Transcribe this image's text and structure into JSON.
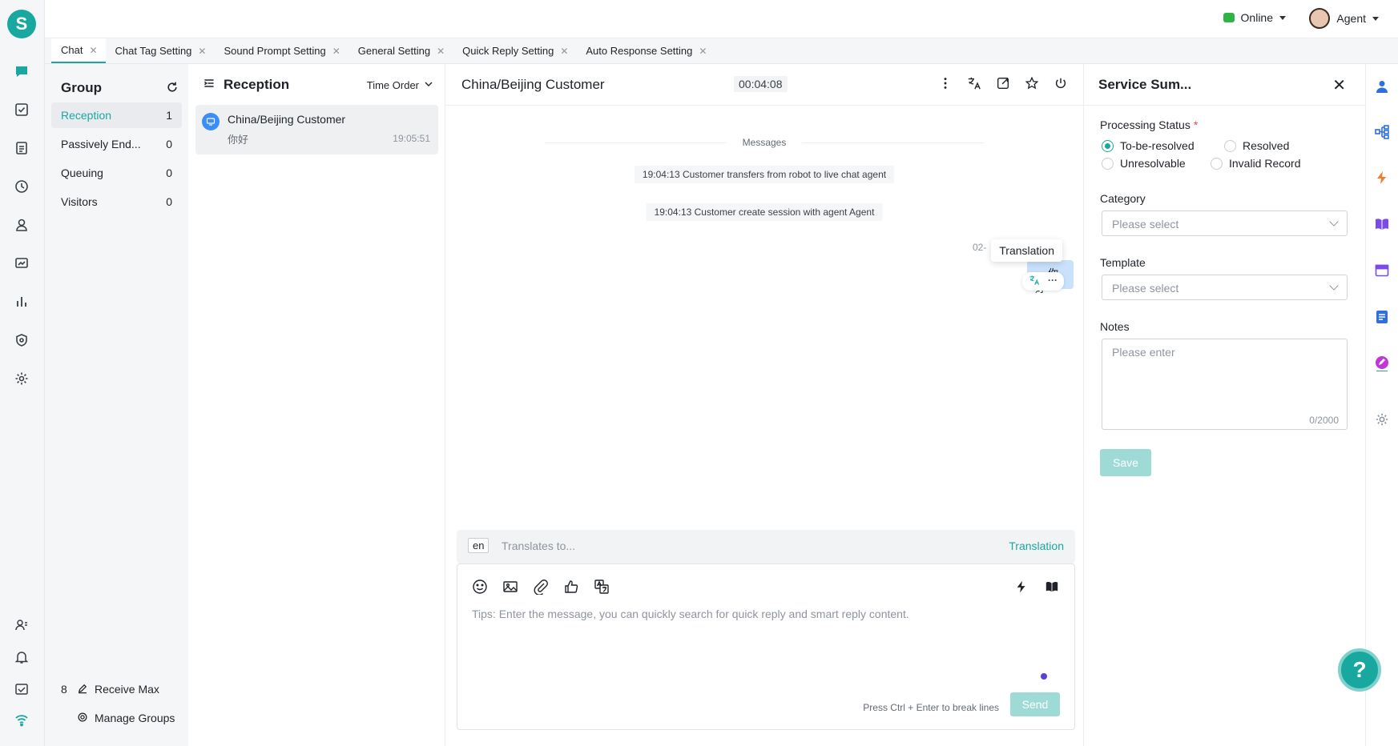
{
  "app": {
    "logo_letter": "S",
    "accent": "#19a8a0"
  },
  "topbar": {
    "status": "Online",
    "agent_name": "Agent"
  },
  "tabs": [
    {
      "label": "Chat",
      "active": true
    },
    {
      "label": "Chat Tag Setting"
    },
    {
      "label": "Sound Prompt Setting"
    },
    {
      "label": "General Setting"
    },
    {
      "label": "Quick Reply Setting"
    },
    {
      "label": "Auto Response Setting"
    }
  ],
  "group": {
    "title": "Group",
    "items": [
      {
        "label": "Reception",
        "count": "1"
      },
      {
        "label": "Passively End...",
        "count": "0"
      },
      {
        "label": "Queuing",
        "count": "0"
      },
      {
        "label": "Visitors",
        "count": "0"
      }
    ],
    "receive_max_label": "Receive Max",
    "receive_max_value": "8",
    "manage_groups_label": "Manage Groups"
  },
  "reception": {
    "title": "Reception",
    "sort_label": "Time Order",
    "conversations": [
      {
        "name": "China/Beijing Customer",
        "last_message": "你好",
        "time": "19:05:51"
      }
    ]
  },
  "chat": {
    "title": "China/Beijing Customer",
    "timer": "00:04:08",
    "divider_label": "Messages",
    "system_messages": [
      "19:04:13 Customer transfers from robot to live chat agent",
      "19:04:13 Customer create session with agent Agent"
    ],
    "bubble_meta": "02-",
    "bubble_meta_tail": "e",
    "bubble_text": "你好",
    "tooltip": "Translation",
    "bubble_dots": "···",
    "translate_lang": "en",
    "translate_placeholder": "Translates to...",
    "translate_button": "Translation",
    "composer_tip": "Tips: Enter the message, you can quickly search for quick reply and smart reply content.",
    "composer_hint": "Press Ctrl + Enter to break lines",
    "send_label": "Send"
  },
  "summary": {
    "title": "Service Sum...",
    "processing_status_label": "Processing Status",
    "required_mark": "*",
    "status_options": [
      "To-be-resolved",
      "Resolved",
      "Unresolvable",
      "Invalid Record"
    ],
    "selected_status": "To-be-resolved",
    "category_label": "Category",
    "category_placeholder": "Please select",
    "template_label": "Template",
    "template_placeholder": "Please select",
    "notes_label": "Notes",
    "notes_placeholder": "Please enter",
    "notes_count": "0/2000",
    "save_label": "Save"
  },
  "help_label": "?"
}
